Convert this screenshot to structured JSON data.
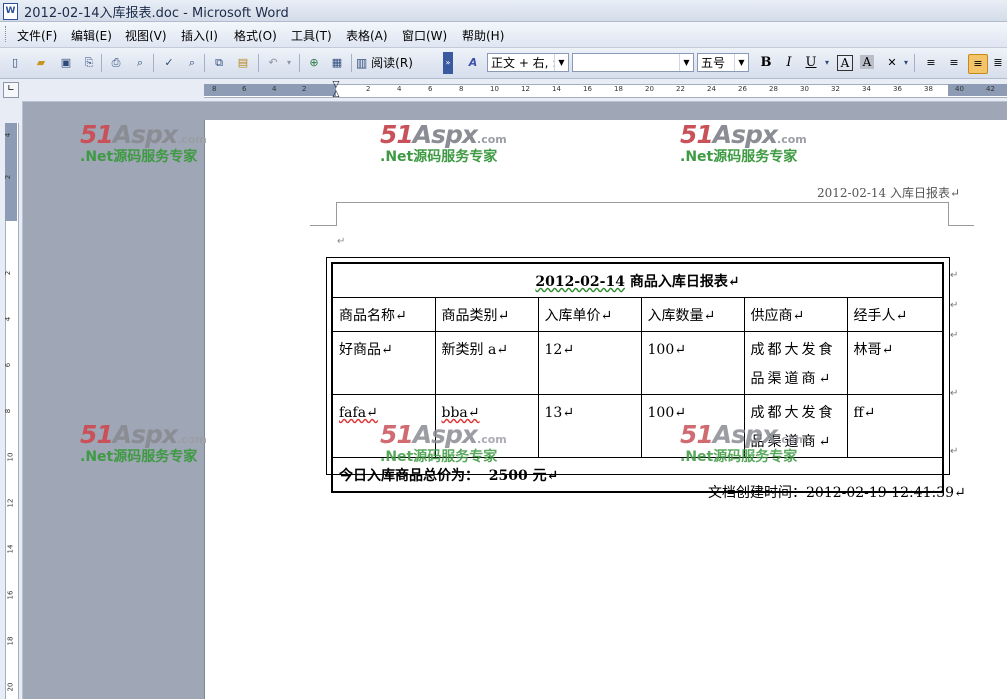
{
  "window": {
    "title": "2012-02-14入库报表.doc - Microsoft Word",
    "app_icon": "W"
  },
  "menu": [
    "文件(F)",
    "编辑(E)",
    "视图(V)",
    "插入(I)",
    "格式(O)",
    "工具(T)",
    "表格(A)",
    "窗口(W)",
    "帮助(H)"
  ],
  "toolbar": {
    "read_label": "阅读(R)",
    "style_value": "正文 + 右, :",
    "font_value": "",
    "size_value": "五号",
    "bold": "B",
    "italic": "I",
    "underline": "U",
    "char_border": "A",
    "char_shade": "A"
  },
  "ruler": {
    "h_ticks": [
      "8",
      "6",
      "4",
      "2",
      "2",
      "4",
      "6",
      "8",
      "10",
      "12",
      "14",
      "16",
      "18",
      "20",
      "22",
      "24",
      "26",
      "28",
      "30",
      "32",
      "34",
      "36",
      "38",
      "40",
      "42"
    ],
    "v_ticks": [
      "4",
      "2",
      "2",
      "4",
      "6",
      "8",
      "10",
      "12",
      "14",
      "16",
      "18",
      "20"
    ]
  },
  "watermark": {
    "logo_main": "51",
    "logo_mid": "Aspx",
    "logo_tld": ".com",
    "tagline": ".Net源码服务专家"
  },
  "document": {
    "header_text": "2012-02-14 入库日报表↵",
    "para_mark": "↵",
    "table_title_date": "2012-02-14",
    "table_title_rest": " 商品入库日报表↵",
    "columns": [
      "商品名称↵",
      "商品类别↵",
      "入库单价↵",
      "入库数量↵",
      "供应商↵",
      "经手人↵"
    ],
    "rows": [
      [
        "好商品↵",
        "新类别 a↵",
        "12↵",
        "100↵",
        "成都大发食品渠道商↵",
        "林哥↵"
      ],
      [
        "fafa↵",
        "bba↵",
        "13↵",
        "100↵",
        "成都大发食品渠道商↵",
        "ff↵"
      ]
    ],
    "total_label": "今日入库商品总价为：",
    "total_value": "2500 元↵",
    "created_line": "文档创建时间：2012-02-19 12:41:39↵"
  }
}
